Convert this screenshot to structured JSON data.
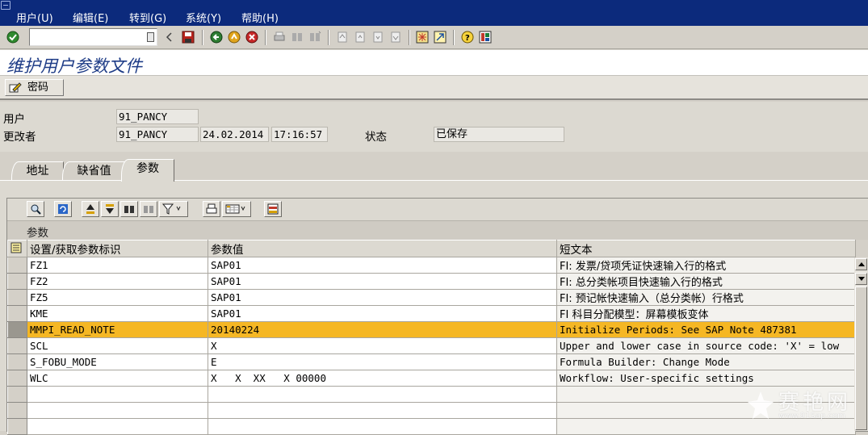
{
  "menu": {
    "items": [
      "用户(U)",
      "编辑(E)",
      "转到(G)",
      "系统(Y)",
      "帮助(H)"
    ]
  },
  "toolbar": {
    "command_value": "",
    "icons": [
      "enter-icon",
      "save-icon",
      "back-icon",
      "exit-icon",
      "cancel-icon",
      "print-icon",
      "find-icon",
      "find-next-icon",
      "first-page-icon",
      "previous-page-icon",
      "next-page-icon",
      "last-page-icon",
      "new-session-icon",
      "shortcut-icon",
      "help-icon",
      "customize-layout-icon"
    ]
  },
  "page": {
    "title": "维护用户参数文件"
  },
  "app_toolbar": {
    "password_label": "密码"
  },
  "header": {
    "user_label": "用户",
    "user_value": "91_PANCY",
    "changed_by_label": "更改者",
    "changed_by_value": "91_PANCY",
    "change_date": "24.02.2014",
    "change_time": "17:16:57",
    "status_label": "状态",
    "status_value": "已保存"
  },
  "tabs": [
    {
      "label": "地址",
      "active": false
    },
    {
      "label": "缺省值",
      "active": false
    },
    {
      "label": "参数",
      "active": true
    }
  ],
  "grid": {
    "title": "参数",
    "columns": [
      "设置/获取参数标识",
      "参数值",
      "短文本"
    ],
    "rows": [
      {
        "id": "FZ1",
        "value": "SAP01",
        "text": "FI: 发票/贷项凭证快速输入行的格式"
      },
      {
        "id": "FZ2",
        "value": "SAP01",
        "text": "FI: 总分类帐项目快速输入行的格式"
      },
      {
        "id": "FZ5",
        "value": "SAP01",
        "text": "FI: 预记帐快速输入（总分类帐）行格式"
      },
      {
        "id": "KME",
        "value": "SAP01",
        "text": "FI 科目分配模型：屏幕模板变体"
      },
      {
        "id": "MMPI_READ_NOTE",
        "value": "20140224",
        "text": "Initialize Periods: See SAP Note 487381"
      },
      {
        "id": "SCL",
        "value": "X",
        "text": "Upper and lower case in source code: 'X' = low"
      },
      {
        "id": "S_FOBU_MODE",
        "value": "E",
        "text": "Formula Builder: Change Mode"
      },
      {
        "id": "WLC",
        "value": "X   X  XX   X 00000",
        "text": "Workflow: User-specific settings"
      },
      {
        "id": "",
        "value": "",
        "text": ""
      },
      {
        "id": "",
        "value": "",
        "text": ""
      },
      {
        "id": "",
        "value": "",
        "text": ""
      }
    ],
    "highlight_row": 4,
    "highlight_color": "#f5b724"
  },
  "watermark": {
    "name": "赛艳网",
    "url": "www.91Sap.com"
  },
  "colors": {
    "menubar": "#0c2a7c",
    "title_text": "#1d3b86",
    "background": "#d4d0c8"
  }
}
